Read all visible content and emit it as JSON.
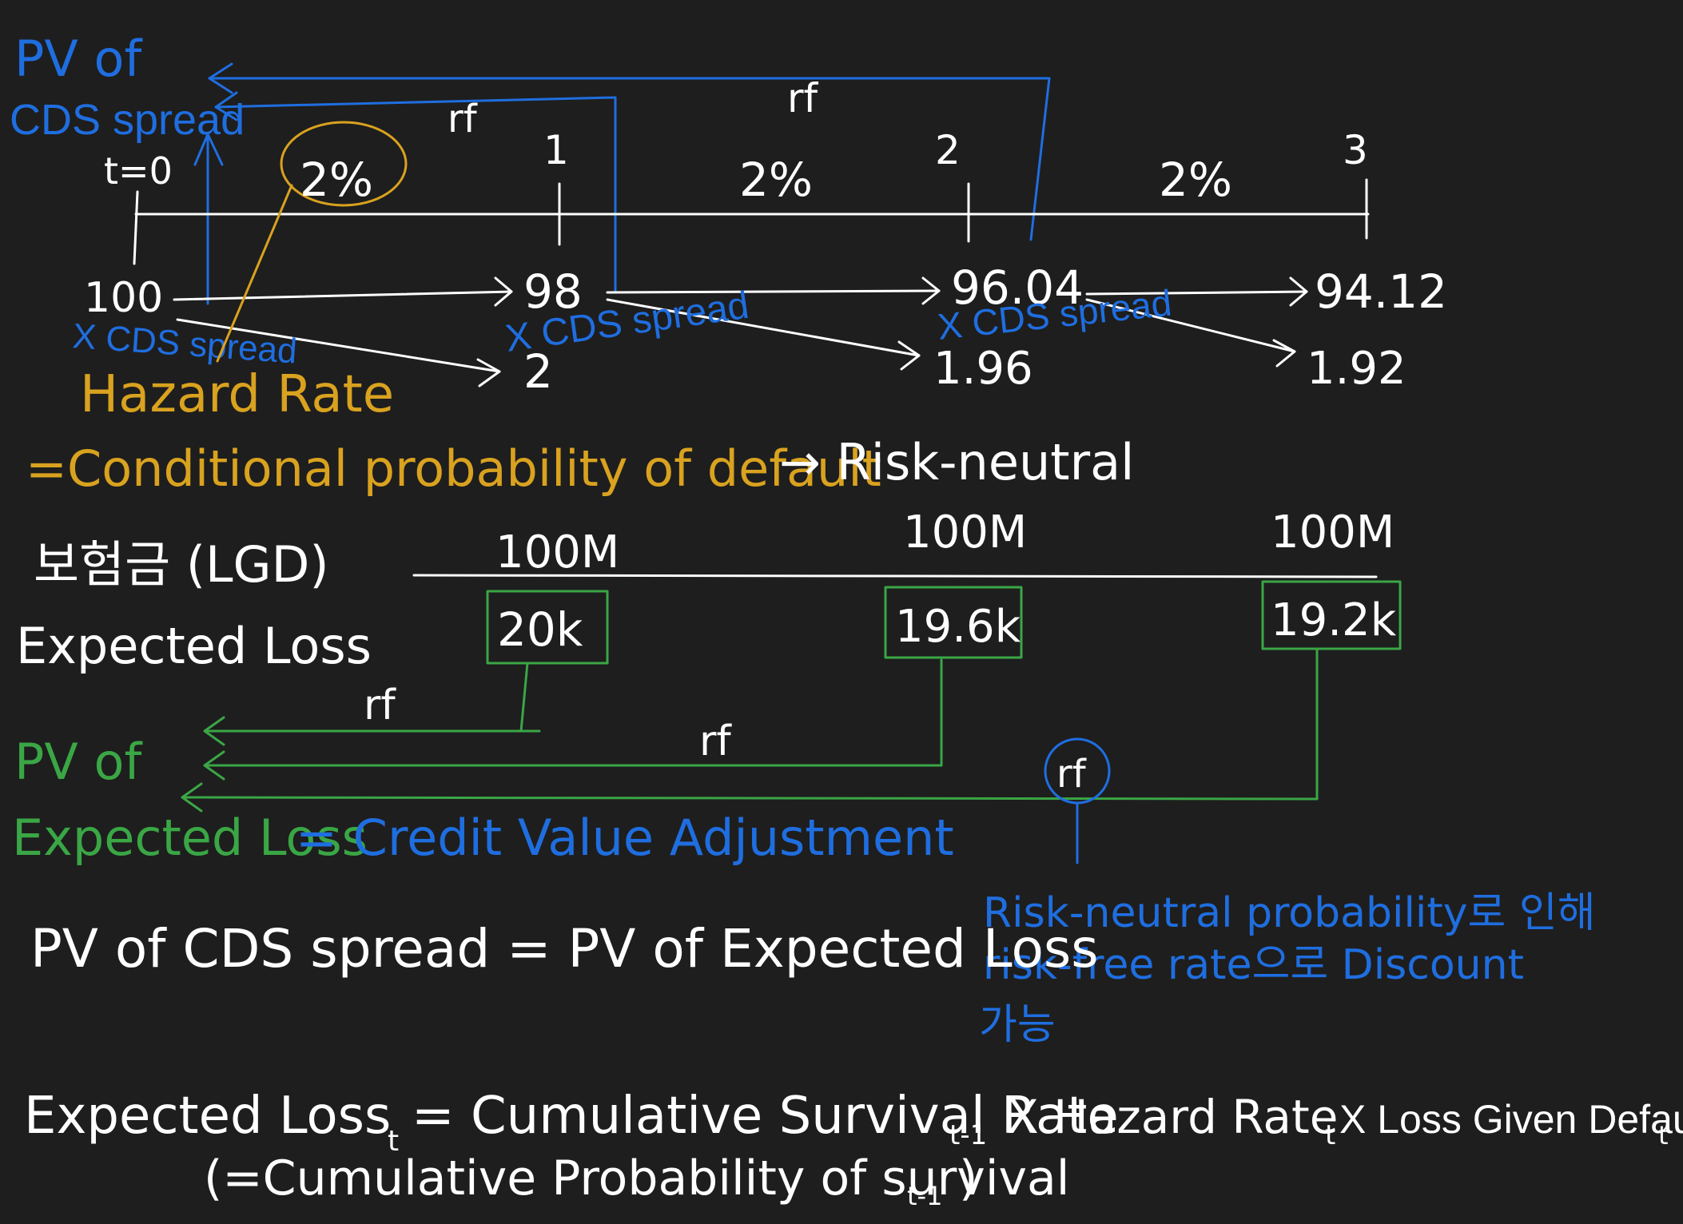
{
  "colors": {
    "background": "#1e1e1e",
    "white": "#ffffff",
    "blue": "#1f6ee0",
    "gold": "#d9a21f",
    "green": "#3aa645"
  },
  "cds": {
    "pv_label_line1": "PV of",
    "pv_label_line2": "CDS spread",
    "rf_labels": [
      "rf",
      "rf"
    ],
    "time_labels": [
      "t=0",
      "1",
      "2",
      "3"
    ],
    "hazard_rates": [
      "2%",
      "2%",
      "2%"
    ],
    "survival_values": [
      "100",
      "98",
      "96.04",
      "94.12"
    ],
    "default_values": [
      "2",
      "1.96",
      "1.92"
    ],
    "spread_labels": [
      "X CDS spread",
      "X CDS spread",
      "X CDS spread"
    ]
  },
  "hazard": {
    "title": "Hazard Rate",
    "definition": "=Conditional probability of default",
    "arrow_target": "→ Risk-neutral"
  },
  "loss": {
    "lgd_label": "보험금 (LGD)",
    "expected_loss_label": "Expected Loss",
    "lgd_values": [
      "100M",
      "100M",
      "100M"
    ],
    "expected_loss_values": [
      "20k",
      "19.6k",
      "19.2k"
    ],
    "rf_labels": [
      "rf",
      "rf",
      "rf"
    ]
  },
  "cva": {
    "pv_line1": "PV of",
    "pv_line2": "Expected Loss",
    "equals_text": "= Credit Value Adjustment"
  },
  "note": {
    "line1": "Risk-neutral probability로 인해",
    "line2": "risk-free rate으로 Discount",
    "line3": "가능"
  },
  "equations": {
    "equality": "PV of CDS spread = PV of Expected Loss",
    "el_lhs": "Expected Loss",
    "el_lhs_sub": "t",
    "el_rhs": "= Cumulative Survival Rate",
    "el_rhs_sub1": "t-1",
    "el_times1": "X Hazard Rate",
    "el_rhs_sub2": "t",
    "el_times2": "X Loss Given Default",
    "el_rhs_sub3": "t",
    "el_note": "(=Cumulative Probability of survival",
    "el_note_sub": "t-1",
    "el_note_close": ")"
  }
}
